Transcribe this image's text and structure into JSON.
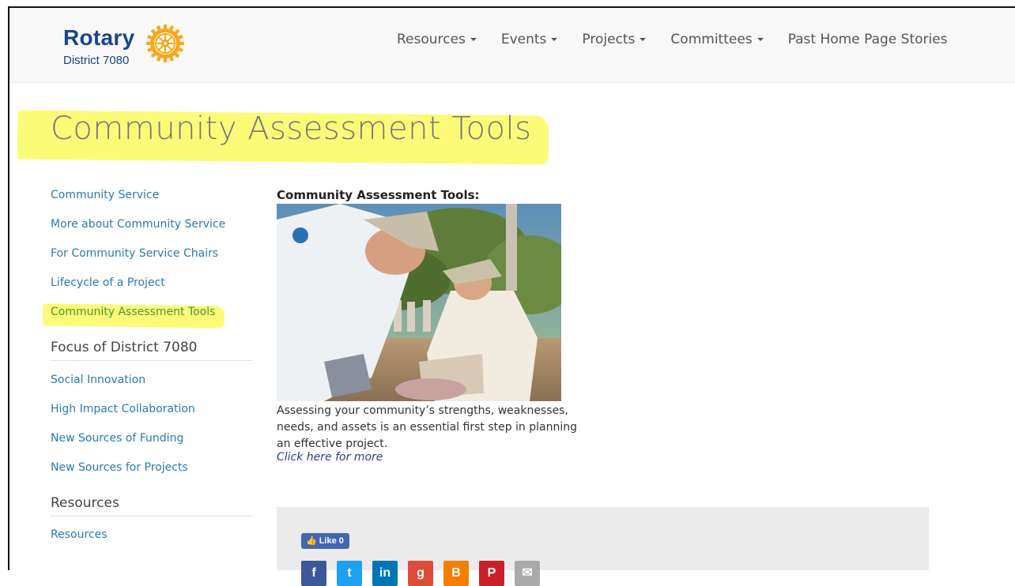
{
  "brand": {
    "name": "Rotary",
    "district": "District 7080",
    "color": "#17458f",
    "wheel_color": "#f7a81b"
  },
  "nav": {
    "items": [
      {
        "label": "Resources",
        "dropdown": true
      },
      {
        "label": "Events",
        "dropdown": true
      },
      {
        "label": "Projects",
        "dropdown": true
      },
      {
        "label": "Committees",
        "dropdown": true
      },
      {
        "label": "Past Home Page Stories",
        "dropdown": false
      }
    ]
  },
  "page": {
    "title": "Community Assessment Tools",
    "highlight_color": "#fafa60"
  },
  "sidebar": {
    "links_top": [
      "Community Service",
      "More about Community Service",
      "For Community Service Chairs",
      "Lifecycle of a Project",
      "Community Assessment Tools"
    ],
    "focus_heading": "Focus of District 7080",
    "focus_links": [
      "Social Innovation",
      "High Impact Collaboration",
      "New Sources of Funding",
      "New Sources for Projects"
    ],
    "resources_heading": "Resources",
    "resources_links": [
      "Resources"
    ]
  },
  "content": {
    "heading": "Community Assessment Tools:",
    "caption": "Assessing your community’s strengths, weaknesses, needs, and assets is an essential first step in planning an effective project.",
    "more_link": "Click here for more"
  },
  "share": {
    "like_label": "Like 0",
    "icons": [
      {
        "name": "facebook-icon",
        "glyph": "f",
        "color": "#3b5998"
      },
      {
        "name": "twitter-icon",
        "glyph": "t",
        "color": "#1da1f2"
      },
      {
        "name": "linkedin-icon",
        "glyph": "in",
        "color": "#0077b5"
      },
      {
        "name": "google-plus-icon",
        "glyph": "g",
        "color": "#dd4b39"
      },
      {
        "name": "blogger-icon",
        "glyph": "B",
        "color": "#f57d00"
      },
      {
        "name": "pinterest-icon",
        "glyph": "P",
        "color": "#cb2027"
      },
      {
        "name": "email-icon",
        "glyph": "✉",
        "color": "#aaaaaa"
      }
    ]
  }
}
